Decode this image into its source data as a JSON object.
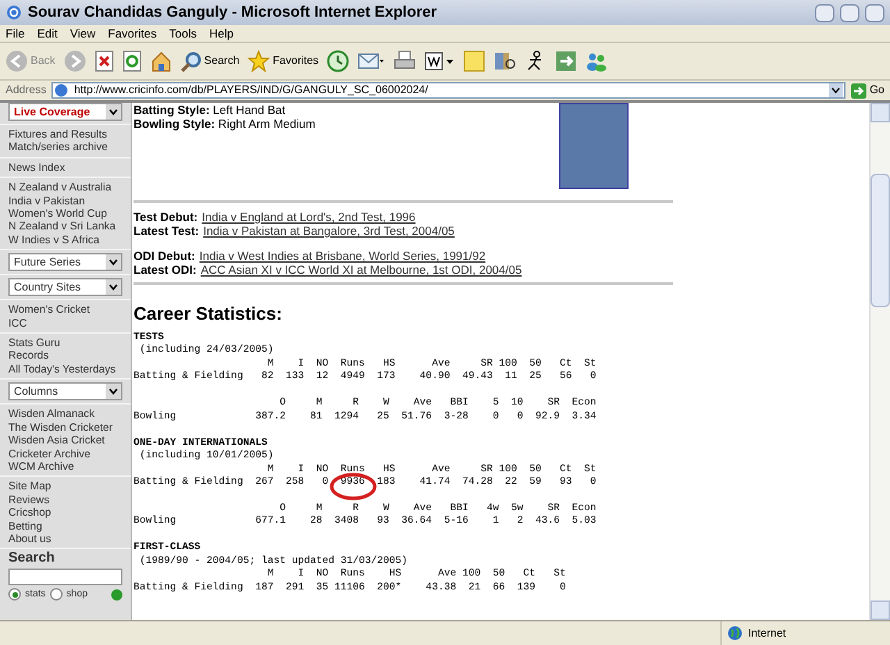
{
  "window": {
    "title": "Sourav Chandidas Ganguly - Microsoft Internet Explorer"
  },
  "menu": [
    "File",
    "Edit",
    "View",
    "Favorites",
    "Tools",
    "Help"
  ],
  "toolbar": {
    "back": "Back",
    "search": "Search",
    "favorites": "Favorites"
  },
  "address": {
    "label": "Address",
    "url": "http://www.cricinfo.com/db/PLAYERS/IND/G/GANGULY_SC_06002024/",
    "go": "Go"
  },
  "sidebar": {
    "sections": [
      {
        "kind": "select",
        "label": "Live Coverage"
      },
      {
        "kind": "links",
        "items": [
          "Fixtures and Results",
          "Match/series archive"
        ]
      },
      {
        "kind": "links",
        "items": [
          "News Index"
        ]
      },
      {
        "kind": "links",
        "items": [
          "N Zealand v Australia",
          "India v Pakistan",
          "Women's World Cup",
          "N Zealand v Sri Lanka",
          "W Indies v S Africa"
        ]
      },
      {
        "kind": "select",
        "label": "Future Series"
      },
      {
        "kind": "select",
        "label": "Country Sites"
      },
      {
        "kind": "links",
        "items": [
          "Women's Cricket",
          "ICC"
        ]
      },
      {
        "kind": "links",
        "items": [
          "Stats Guru",
          "Records",
          "All Today's Yesterdays"
        ]
      },
      {
        "kind": "select",
        "label": "Columns"
      },
      {
        "kind": "links",
        "items": [
          "Wisden Almanack",
          "The Wisden Cricketer",
          "Wisden Asia Cricket",
          "Cricketer Archive",
          "WCM Archive"
        ]
      },
      {
        "kind": "links",
        "items": [
          "Site Map",
          "Reviews",
          "Cricshop",
          "Betting",
          "About us"
        ]
      }
    ],
    "search": {
      "title": "Search",
      "options": [
        {
          "label": "stats",
          "selected": true
        },
        {
          "label": "shop",
          "selected": false
        }
      ]
    }
  },
  "profile": {
    "styles": [
      {
        "label": "Batting Style:",
        "value": "Left Hand Bat"
      },
      {
        "label": "Bowling Style:",
        "value": "Right Arm Medium"
      }
    ],
    "debuts": [
      [
        {
          "label": "Test Debut:",
          "link": "India v England at Lord's, 2nd Test, 1996"
        },
        {
          "label": "Latest Test:",
          "link": "India v Pakistan at Bangalore, 3rd Test, 2004/05"
        }
      ],
      [
        {
          "label": "ODI Debut:",
          "link": "India v West Indies at Brisbane, World Series, 1991/92"
        },
        {
          "label": "Latest ODI:",
          "link": "ACC Asian XI v ICC World XI at Melbourne, 1st ODI, 2004/05"
        }
      ]
    ]
  },
  "heading": "Career Statistics:",
  "stats": [
    {
      "kind": "title",
      "text": "TESTS"
    },
    {
      "kind": "line",
      "text": " (including 24/03/2005)"
    },
    {
      "kind": "line",
      "text": "                      M    I  NO  Runs   HS      Ave     SR 100  50   Ct  St"
    },
    {
      "kind": "line",
      "text": "Batting & Fielding   82  133  12  4949  173    40.90  49.43  11  25   56   0"
    },
    {
      "kind": "blank"
    },
    {
      "kind": "line",
      "text": "                        O     M     R    W    Ave   BBI    5  10    SR  Econ"
    },
    {
      "kind": "line",
      "text": "Bowling             387.2    81  1294   25  51.76  3-28    0   0  92.9  3.34"
    },
    {
      "kind": "blank"
    },
    {
      "kind": "title",
      "text": "ONE-DAY INTERNATIONALS"
    },
    {
      "kind": "line",
      "text": " (including 10/01/2005)"
    },
    {
      "kind": "line",
      "text": "                      M    I  NO  Runs   HS      Ave     SR 100  50   Ct  St"
    },
    {
      "kind": "line",
      "text": "Batting & Fielding  267  258   0  9936  183    41.74  74.28  22  59   93   0"
    },
    {
      "kind": "blank"
    },
    {
      "kind": "line",
      "text": "                        O     M     R    W    Ave   BBI   4w  5w    SR  Econ"
    },
    {
      "kind": "line",
      "text": "Bowling             677.1    28  3408   93  36.64  5-16    1   2  43.6  5.03"
    },
    {
      "kind": "blank"
    },
    {
      "kind": "title",
      "text": "FIRST-CLASS"
    },
    {
      "kind": "line",
      "text": " (1989/90 - 2004/05; last updated 31/03/2005)"
    },
    {
      "kind": "line",
      "text": "                      M    I  NO  Runs    HS      Ave 100  50   Ct   St"
    },
    {
      "kind": "line",
      "text": "Batting & Fielding  187  291  35 11106  200*    43.38  21  66  139    0"
    }
  ],
  "status_bar": {
    "zone": "Internet"
  }
}
